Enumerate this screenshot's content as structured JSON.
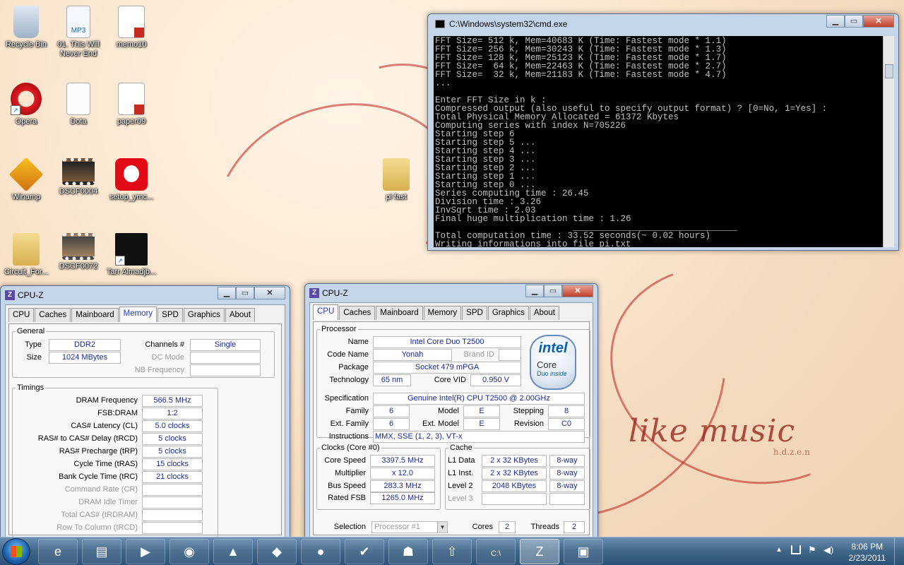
{
  "desktop": {
    "icons": [
      {
        "label": "Recycle Bin",
        "icon": "recycle-bin-icon"
      },
      {
        "label": "01. This Will Never End",
        "icon": "mp3-file-icon"
      },
      {
        "label": "memo10",
        "icon": "pdf-icon"
      },
      {
        "label": "Opera",
        "icon": "opera-icon"
      },
      {
        "label": "Dota",
        "icon": "text-file-icon"
      },
      {
        "label": "paper09",
        "icon": "pdf-icon"
      },
      {
        "label": "Winamp",
        "icon": "winamp-icon"
      },
      {
        "label": "DSCF0004",
        "icon": "video-icon"
      },
      {
        "label": "setup_ymc...",
        "icon": "vodafone-icon"
      },
      {
        "label": "pi fast",
        "icon": "folder-icon"
      },
      {
        "label": "Circuit_For...",
        "icon": "folder-icon"
      },
      {
        "label": "DSCF0072",
        "icon": "video-icon"
      },
      {
        "label": "Tarr Almadjb...",
        "icon": "tarr-icon"
      }
    ],
    "wallpaper_text": "like music",
    "wallpaper_text2": "h.d.z.e.n"
  },
  "cmd": {
    "title": "C:\\Windows\\system32\\cmd.exe",
    "lines": [
      "FFT Size= 512 k, Mem=40683 K (Time: Fastest mode * 1.1)",
      "FFT Size= 256 k, Mem=30243 K (Time: Fastest mode * 1.3)",
      "FFT Size= 128 k, Mem=25123 K (Time: Fastest mode * 1.7)",
      "FFT Size=  64 k, Mem=22463 K (Time: Fastest mode * 2.7)",
      "FFT Size=  32 k, Mem=21183 K (Time: Fastest mode * 4.7)",
      "...",
      "",
      "Enter FFT Size in k :",
      "Compressed output (also useful to specify output format) ? [0=No, 1=Yes] :",
      "Total Physical Memory Allocated = 61372 Kbytes",
      "Computing series with index N=705226",
      "Starting step 6",
      "Starting step 5 ...",
      "Starting step 4 ...",
      "Starting step 3 ...",
      "Starting step 2 ...",
      "Starting step 1 ...",
      "Starting step 0 ...",
      "Series computing time : 26.45",
      "Division time : 3.26",
      "InvSqrt time : 2.03",
      "Final huge multiplication time : 1.26",
      "                          _______________________________",
      "Total computation time : 33.52 seconds(~ 0.02 hours)",
      "Writing informations into file pi.txt"
    ]
  },
  "cpuz_memory": {
    "title": "CPU-Z",
    "tabs": [
      "CPU",
      "Caches",
      "Mainboard",
      "Memory",
      "SPD",
      "Graphics",
      "About"
    ],
    "active_tab": "Memory",
    "general": {
      "legend": "General",
      "type_label": "Type",
      "type": "DDR2",
      "size_label": "Size",
      "size": "1024 MBytes",
      "channels_label": "Channels #",
      "channels": "Single",
      "dc_mode_label": "DC Mode",
      "nb_freq_label": "NB Frequency"
    },
    "timings": {
      "legend": "Timings",
      "rows": [
        {
          "label": "DRAM Frequency",
          "value": "566.5 MHz",
          "dim": false
        },
        {
          "label": "FSB:DRAM",
          "value": "1:2",
          "dim": false
        },
        {
          "label": "CAS# Latency (CL)",
          "value": "5.0 clocks",
          "dim": false
        },
        {
          "label": "RAS# to CAS# Delay (tRCD)",
          "value": "5 clocks",
          "dim": false
        },
        {
          "label": "RAS# Precharge (tRP)",
          "value": "5 clocks",
          "dim": false
        },
        {
          "label": "Cycle Time (tRAS)",
          "value": "15 clocks",
          "dim": false
        },
        {
          "label": "Bank Cycle Time (tRC)",
          "value": "21 clocks",
          "dim": false
        },
        {
          "label": "Command Rate (CR)",
          "value": "",
          "dim": true
        },
        {
          "label": "DRAM Idle Timer",
          "value": "",
          "dim": true
        },
        {
          "label": "Total CAS# (tRDRAM)",
          "value": "",
          "dim": true
        },
        {
          "label": "Row To Column (tRCD)",
          "value": "",
          "dim": true
        }
      ]
    }
  },
  "cpuz_cpu": {
    "title": "CPU-Z",
    "tabs": [
      "CPU",
      "Caches",
      "Mainboard",
      "Memory",
      "SPD",
      "Graphics",
      "About"
    ],
    "active_tab": "CPU",
    "processor": {
      "legend": "Processor",
      "name_label": "Name",
      "name": "Intel Core Duo T2500",
      "codename_label": "Code Name",
      "codename": "Yonah",
      "brandid_label": "Brand ID",
      "brandid": "",
      "package_label": "Package",
      "package": "Socket 479 mPGA",
      "technology_label": "Technology",
      "technology": "65 nm",
      "corevid_label": "Core VID",
      "corevid": "0.950 V",
      "spec_label": "Specification",
      "spec": "Genuine Intel(R) CPU          T2500  @ 2.00GHz",
      "family_label": "Family",
      "family": "6",
      "model_label": "Model",
      "model": "E",
      "stepping_label": "Stepping",
      "stepping": "8",
      "extfamily_label": "Ext. Family",
      "extfamily": "6",
      "extmodel_label": "Ext. Model",
      "extmodel": "E",
      "revision_label": "Revision",
      "revision": "C0",
      "instructions_label": "Instructions",
      "instructions": "MMX, SSE (1, 2, 3), VT-x"
    },
    "logo": {
      "brand": "intel",
      "line1": "Core",
      "line2": "Duo",
      "line3": "inside"
    },
    "clocks": {
      "legend": "Clocks (Core #0)",
      "core_speed_label": "Core Speed",
      "core_speed": "3397.5 MHz",
      "multiplier_label": "Multiplier",
      "multiplier": "x 12.0",
      "bus_speed_label": "Bus Speed",
      "bus_speed": "283.3 MHz",
      "rated_fsb_label": "Rated FSB",
      "rated_fsb": "1265.0 MHz"
    },
    "cache": {
      "legend": "Cache",
      "rows": [
        {
          "label": "L1 Data",
          "size": "2 x 32 KBytes",
          "way": "8-way",
          "dim": false
        },
        {
          "label": "L1 Inst.",
          "size": "2 x 32 KBytes",
          "way": "8-way",
          "dim": false
        },
        {
          "label": "Level 2",
          "size": "2048 KBytes",
          "way": "8-way",
          "dim": false
        },
        {
          "label": "Level 3",
          "size": "",
          "way": "",
          "dim": true
        }
      ]
    },
    "selection_label": "Selection",
    "selection": "Processor #1",
    "cores_label": "Cores",
    "cores": "2",
    "threads_label": "Threads",
    "threads": "2"
  },
  "taskbar": {
    "items": [
      "ie-icon",
      "explorer-icon",
      "media-player-icon",
      "chrome-icon",
      "vlc-icon",
      "app-icon",
      "vodafone-icon",
      "task-icon",
      "game-icon",
      "upload-icon",
      "cmd-icon",
      "cpuz-icon",
      "photo-icon"
    ],
    "time": "8:06 PM",
    "date": "2/23/2011"
  }
}
